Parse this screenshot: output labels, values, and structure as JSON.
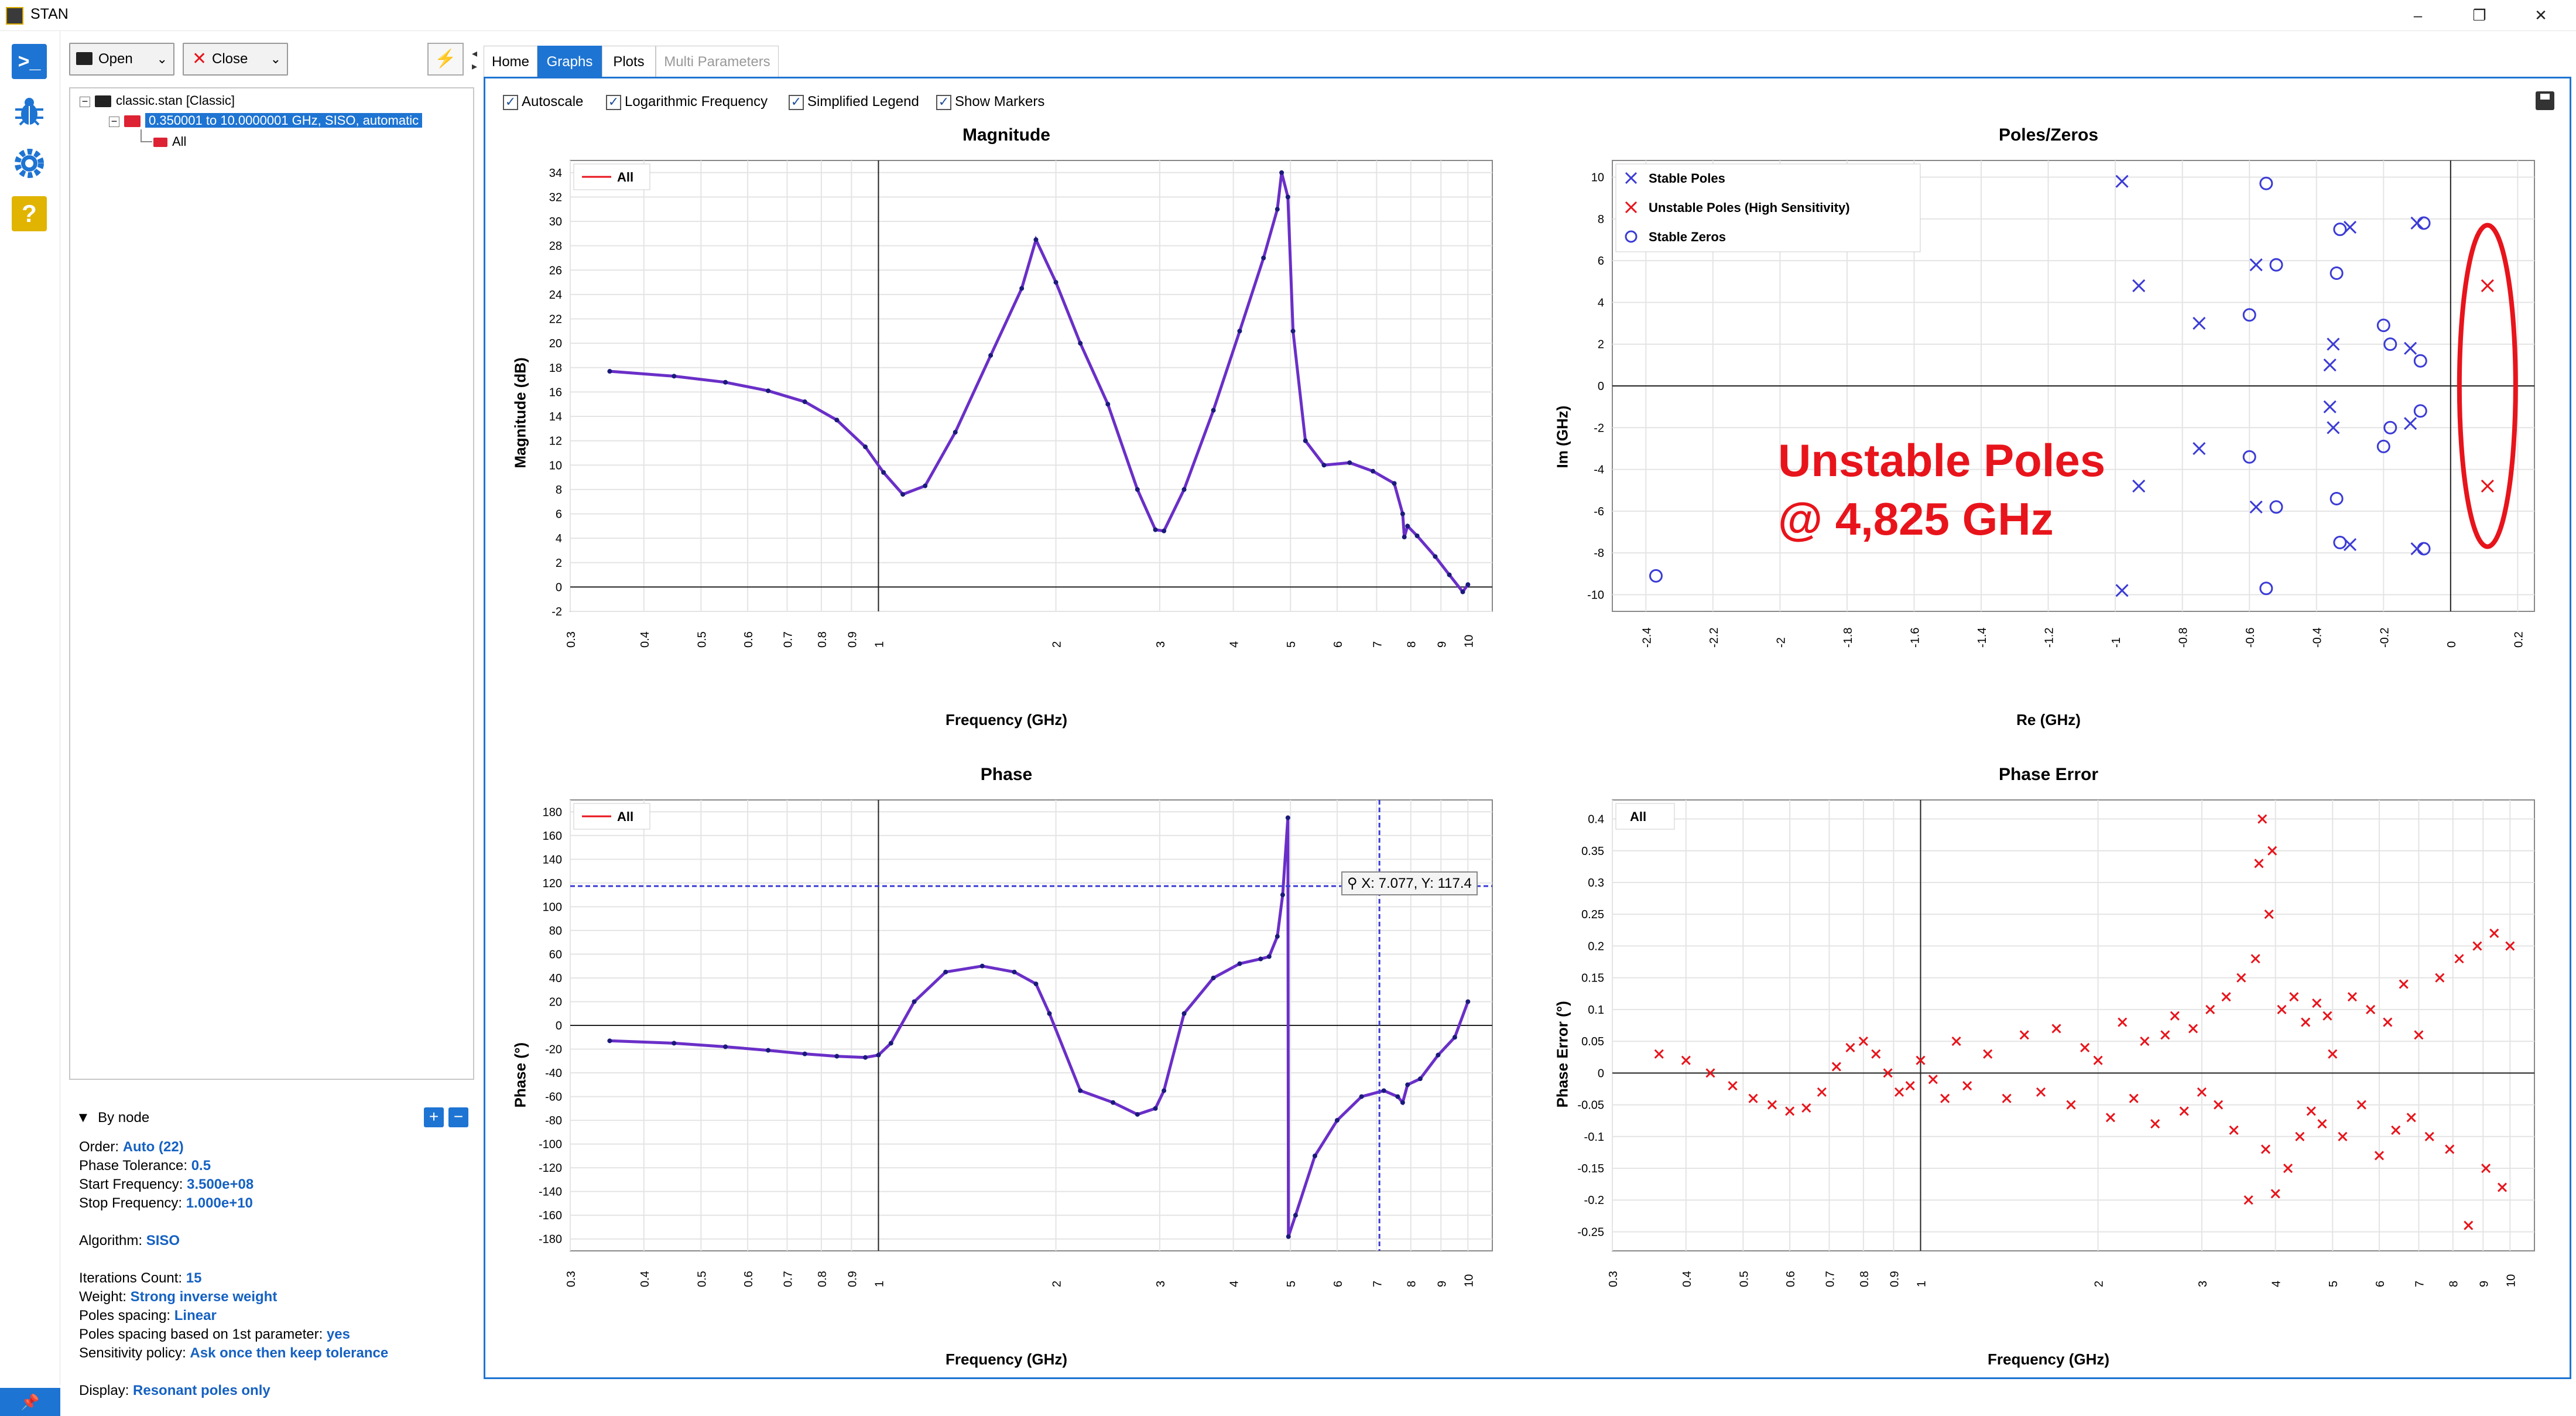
{
  "window": {
    "title": "STAN"
  },
  "toolbar": {
    "open_label": "Open",
    "close_label": "Close"
  },
  "tree": {
    "root_label": "classic.stan [Classic]",
    "child_label": "0.350001 to 10.0000001 GHz, SISO, automatic",
    "leaf_label": "All"
  },
  "tabs": [
    {
      "label": "Home",
      "state": "normal"
    },
    {
      "label": "Graphs",
      "state": "active"
    },
    {
      "label": "Plots",
      "state": "normal"
    },
    {
      "label": "Multi Parameters",
      "state": "disabled"
    }
  ],
  "options": [
    {
      "label": "Autoscale",
      "checked": true
    },
    {
      "label": "Logarithmic Frequency",
      "checked": true
    },
    {
      "label": "Simplified Legend",
      "checked": true
    },
    {
      "label": "Show Markers",
      "checked": true
    }
  ],
  "props": {
    "by_node_label": "By node",
    "order_label": "Order:",
    "order_value": "Auto (22)",
    "phase_tol_label": "Phase Tolerance:",
    "phase_tol_value": "0.5",
    "start_freq_label": "Start Frequency:",
    "start_freq_value": "3.500e+08",
    "stop_freq_label": "Stop Frequency:",
    "stop_freq_value": "1.000e+10",
    "algorithm_label": "Algorithm:",
    "algorithm_value": "SISO",
    "iter_label": "Iterations Count:",
    "iter_value": "15",
    "weight_label": "Weight:",
    "weight_value": "Strong inverse weight",
    "spacing_label": "Poles spacing:",
    "spacing_value": "Linear",
    "spacing_param_label": "Poles spacing based on 1st parameter:",
    "spacing_param_value": "yes",
    "sensitivity_label": "Sensitivity policy:",
    "sensitivity_value": "Ask once then keep tolerance",
    "display_label": "Display:",
    "display_value": "Resonant poles only"
  },
  "annotation": {
    "line1": "Unstable Poles",
    "line2": "@ 4,825 GHz",
    "color": "#e8141b"
  },
  "cursor_readout": "X: 7.077, Y: 117.4",
  "colors": {
    "accent": "#1e74d2",
    "trace": "#6a2fc8",
    "marker": "#1a1a7a",
    "unstable": "#e8141b",
    "stable": "#3b3bd6"
  },
  "chart_data": [
    {
      "type": "line",
      "title": "Magnitude",
      "xlabel": "Frequency (GHz)",
      "ylabel": "Magnitude (dB)",
      "xscale": "log",
      "xlim": [
        0.3,
        11
      ],
      "ylim": [
        -2,
        35
      ],
      "xticks": [
        "0.3",
        "0.4",
        "0.5",
        "0.6",
        "0.7",
        "0.8",
        "0.9",
        "1",
        "2",
        "3",
        "4",
        "5",
        "6",
        "7",
        "8",
        "9",
        "10"
      ],
      "yticks": [
        "-2",
        "0",
        "2",
        "4",
        "6",
        "8",
        "10",
        "12",
        "14",
        "16",
        "18",
        "20",
        "22",
        "24",
        "26",
        "28",
        "30",
        "32",
        "34"
      ],
      "series": [
        {
          "name": "All",
          "x": [
            0.35,
            0.45,
            0.55,
            0.65,
            0.75,
            0.85,
            0.95,
            1.02,
            1.1,
            1.2,
            1.35,
            1.55,
            1.75,
            1.85,
            2.0,
            2.2,
            2.45,
            2.75,
            2.95,
            3.05,
            3.3,
            3.7,
            4.1,
            4.5,
            4.75,
            4.83,
            4.95,
            5.05,
            5.3,
            5.7,
            6.3,
            6.9,
            7.5,
            7.75,
            7.8,
            7.9,
            8.2,
            8.8,
            9.3,
            9.8,
            10.0
          ],
          "y": [
            17.7,
            17.3,
            16.8,
            16.1,
            15.2,
            13.7,
            11.5,
            9.4,
            7.6,
            8.3,
            12.7,
            19.0,
            24.5,
            28.5,
            25.0,
            20.0,
            15.0,
            8.0,
            4.7,
            4.6,
            8.0,
            14.5,
            21.0,
            27.0,
            31.0,
            34.0,
            32.0,
            21.0,
            12.0,
            10.0,
            10.2,
            9.5,
            8.5,
            6.0,
            4.1,
            5.0,
            4.2,
            2.5,
            1.0,
            -0.4,
            0.2
          ]
        }
      ]
    },
    {
      "type": "scatter",
      "title": "Poles/Zeros",
      "xlabel": "Re (GHz)",
      "ylabel": "Im (GHz)",
      "xlim": [
        -2.5,
        0.25
      ],
      "ylim": [
        -10.8,
        10.8
      ],
      "xticks": [
        "-2.4",
        "-2.2",
        "-2",
        "-1.8",
        "-1.6",
        "-1.4",
        "-1.2",
        "-1",
        "-0.8",
        "-0.6",
        "-0.4",
        "-0.2",
        "0",
        "0.2"
      ],
      "yticks": [
        "-10",
        "-8",
        "-6",
        "-4",
        "-2",
        "0",
        "2",
        "4",
        "6",
        "8",
        "10"
      ],
      "legend": [
        "Stable Poles",
        "Unstable Poles (High Sensitivity)",
        "Stable Zeros"
      ],
      "series": [
        {
          "name": "Stable Poles",
          "x": [
            -0.98,
            -0.93,
            -0.75,
            -0.58,
            -0.3,
            -0.35,
            -0.36,
            -0.1,
            -0.12,
            -0.98,
            -0.93,
            -0.75,
            -0.58,
            -0.3,
            -0.35,
            -0.36,
            -0.1,
            -0.12
          ],
          "y": [
            9.8,
            4.8,
            3.0,
            5.8,
            7.6,
            2.0,
            1.0,
            7.8,
            1.8,
            -9.8,
            -4.8,
            -3.0,
            -5.8,
            -7.6,
            -2.0,
            -1.0,
            -7.8,
            -1.8
          ]
        },
        {
          "name": "Unstable Poles (High Sensitivity)",
          "x": [
            0.11,
            0.11
          ],
          "y": [
            4.8,
            -4.8
          ]
        },
        {
          "name": "Stable Zeros",
          "x": [
            -2.37,
            -0.55,
            -0.52,
            -0.6,
            -0.33,
            -0.34,
            -0.2,
            -0.18,
            -0.09,
            -0.08,
            -0.55,
            -0.52,
            -0.6,
            -0.33,
            -0.34,
            -0.2,
            -0.18,
            -0.09,
            -0.08
          ],
          "y": [
            -9.1,
            9.7,
            5.8,
            3.4,
            7.5,
            5.4,
            2.9,
            2.0,
            1.2,
            7.8,
            -9.7,
            -5.8,
            -3.4,
            -7.5,
            -5.4,
            -2.9,
            -2.0,
            -1.2,
            -7.8
          ]
        }
      ]
    },
    {
      "type": "line",
      "title": "Phase",
      "xlabel": "Frequency (GHz)",
      "ylabel": "Phase (°)",
      "xscale": "log",
      "xlim": [
        0.3,
        11
      ],
      "ylim": [
        -190,
        190
      ],
      "xticks": [
        "0.3",
        "0.4",
        "0.5",
        "0.6",
        "0.7",
        "0.8",
        "0.9",
        "1",
        "2",
        "3",
        "4",
        "5",
        "6",
        "7",
        "8",
        "9",
        "10"
      ],
      "yticks": [
        "-180",
        "-160",
        "-140",
        "-120",
        "-100",
        "-80",
        "-60",
        "-40",
        "-20",
        "0",
        "20",
        "40",
        "60",
        "80",
        "100",
        "120",
        "140",
        "160",
        "180"
      ],
      "cursor": {
        "x": 7.077,
        "y": 117.4
      },
      "series": [
        {
          "name": "All",
          "x": [
            0.35,
            0.45,
            0.55,
            0.65,
            0.75,
            0.85,
            0.95,
            1.0,
            1.05,
            1.15,
            1.3,
            1.5,
            1.7,
            1.85,
            1.95,
            2.2,
            2.5,
            2.75,
            2.95,
            3.05,
            3.3,
            3.7,
            4.1,
            4.45,
            4.6,
            4.75,
            4.85,
            4.95,
            4.96,
            5.1,
            5.5,
            6.0,
            6.6,
            7.2,
            7.6,
            7.75,
            7.9,
            8.3,
            8.9,
            9.5,
            10.0
          ],
          "y": [
            -13,
            -15,
            -18,
            -21,
            -24,
            -26,
            -27,
            -25,
            -15,
            20,
            45,
            50,
            45,
            35,
            10,
            -55,
            -65,
            -75,
            -70,
            -55,
            10,
            40,
            52,
            56,
            58,
            75,
            110,
            175,
            -178,
            -160,
            -110,
            -80,
            -60,
            -55,
            -60,
            -65,
            -50,
            -45,
            -25,
            -10,
            20
          ]
        }
      ]
    },
    {
      "type": "scatter",
      "title": "Phase Error",
      "xlabel": "Frequency (GHz)",
      "ylabel": "Phase Error (°)",
      "xscale": "log",
      "xlim": [
        0.3,
        11
      ],
      "ylim": [
        -0.28,
        0.43
      ],
      "xticks": [
        "0.3",
        "0.4",
        "0.5",
        "0.6",
        "0.7",
        "0.8",
        "0.9",
        "1",
        "2",
        "3",
        "4",
        "5",
        "6",
        "7",
        "8",
        "9",
        "10"
      ],
      "yticks": [
        "-0.25",
        "-0.2",
        "-0.15",
        "-0.1",
        "-0.05",
        "0",
        "0.05",
        "0.1",
        "0.15",
        "0.2",
        "0.25",
        "0.3",
        "0.35",
        "0.4"
      ],
      "series": [
        {
          "name": "All",
          "x": [
            0.36,
            0.4,
            0.44,
            0.48,
            0.52,
            0.56,
            0.6,
            0.64,
            0.68,
            0.72,
            0.76,
            0.8,
            0.84,
            0.88,
            0.92,
            0.96,
            1.0,
            1.05,
            1.1,
            1.15,
            1.2,
            1.3,
            1.4,
            1.5,
            1.6,
            1.7,
            1.8,
            1.9,
            2.0,
            2.1,
            2.2,
            2.3,
            2.4,
            2.5,
            2.6,
            2.7,
            2.8,
            2.9,
            3.0,
            3.1,
            3.2,
            3.3,
            3.4,
            3.5,
            3.6,
            3.7,
            3.75,
            3.8,
            3.85,
            3.9,
            3.95,
            4.0,
            4.1,
            4.2,
            4.3,
            4.4,
            4.5,
            4.6,
            4.7,
            4.8,
            4.9,
            5.0,
            5.2,
            5.4,
            5.6,
            5.8,
            6.0,
            6.2,
            6.4,
            6.6,
            6.8,
            7.0,
            7.3,
            7.6,
            7.9,
            8.2,
            8.5,
            8.8,
            9.1,
            9.4,
            9.7,
            10.0
          ],
          "y": [
            0.03,
            0.02,
            0.0,
            -0.02,
            -0.04,
            -0.05,
            -0.06,
            -0.055,
            -0.03,
            0.01,
            0.04,
            0.05,
            0.03,
            0.0,
            -0.03,
            -0.02,
            0.02,
            -0.01,
            -0.04,
            0.05,
            -0.02,
            0.03,
            -0.04,
            0.06,
            -0.03,
            0.07,
            -0.05,
            0.04,
            0.02,
            -0.07,
            0.08,
            -0.04,
            0.05,
            -0.08,
            0.06,
            0.09,
            -0.06,
            0.07,
            -0.03,
            0.1,
            -0.05,
            0.12,
            -0.09,
            0.15,
            -0.2,
            0.18,
            0.33,
            0.4,
            -0.12,
            0.25,
            0.35,
            -0.19,
            0.1,
            -0.15,
            0.12,
            -0.1,
            0.08,
            -0.06,
            0.11,
            -0.08,
            0.09,
            0.03,
            -0.1,
            0.12,
            -0.05,
            0.1,
            -0.13,
            0.08,
            -0.09,
            0.14,
            -0.07,
            0.06,
            -0.1,
            0.15,
            -0.12,
            0.18,
            -0.24,
            0.2,
            -0.15,
            0.22,
            -0.18,
            0.2
          ]
        }
      ]
    }
  ]
}
